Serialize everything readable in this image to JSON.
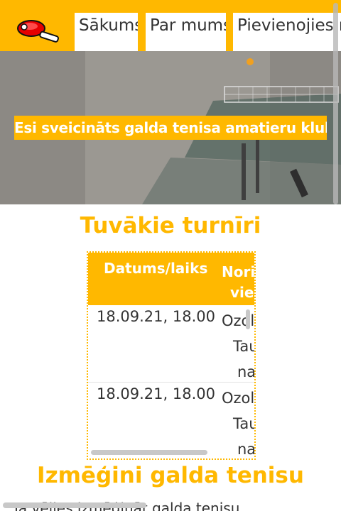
{
  "nav": {
    "items": [
      {
        "label": "Sākums"
      },
      {
        "label": "Par mums"
      },
      {
        "label": "Pievienojies mums"
      }
    ]
  },
  "hero": {
    "title": "Esi sveicināts galda tenisa amatieru klubā!"
  },
  "tournaments": {
    "heading": "Tuvākie turnīri",
    "columns": [
      "Datums/laiks",
      "Noris",
      "vie"
    ],
    "rows": [
      {
        "date": "18.09.21, 18.00",
        "venue": [
          "Ozol",
          "Tau",
          "na"
        ]
      },
      {
        "date": "18.09.21, 18.00",
        "venue": [
          "Ozol",
          "Tau",
          "na"
        ]
      }
    ]
  },
  "trial": {
    "heading": "Izmēģini galda tenisu",
    "text": "Ja vēlies izmēģināt galda tenisu"
  },
  "colors": {
    "accent": "#ffb800",
    "text": "#333333"
  },
  "icons": {
    "logo": "table-tennis-paddle-icon"
  }
}
